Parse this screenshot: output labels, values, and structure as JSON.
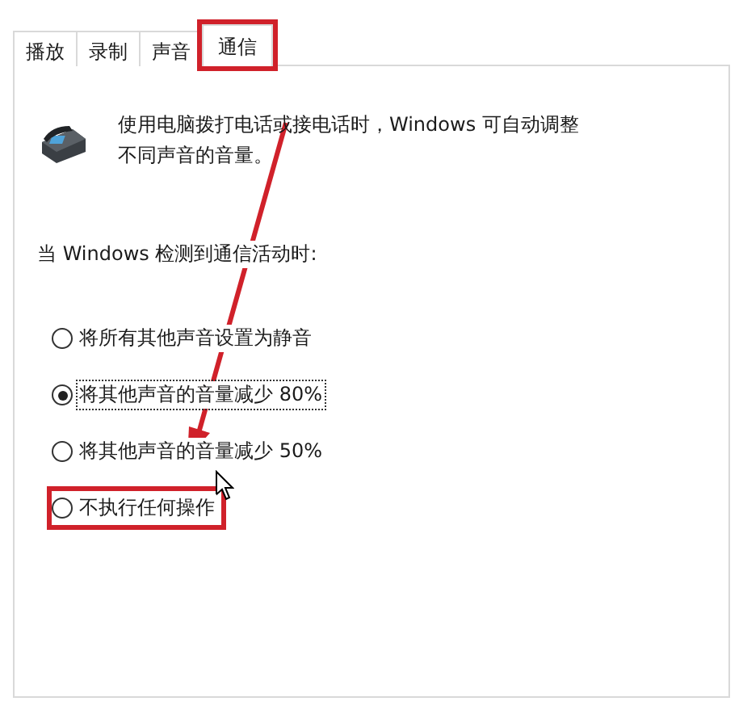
{
  "tabs": [
    {
      "label": "播放",
      "selected": false,
      "highlighted": false
    },
    {
      "label": "录制",
      "selected": false,
      "highlighted": false
    },
    {
      "label": "声音",
      "selected": false,
      "highlighted": false
    },
    {
      "label": "通信",
      "selected": true,
      "highlighted": true
    }
  ],
  "description": "使用电脑拨打电话或接电话时，Windows 可自动调整不同声音的音量。",
  "heading": "当 Windows 检测到通信活动时:",
  "options": [
    {
      "label": "将所有其他声音设置为静音",
      "selected": false,
      "highlighted": false
    },
    {
      "label": "将其他声音的音量减少 80%",
      "selected": true,
      "highlighted": false
    },
    {
      "label": "将其他声音的音量减少 50%",
      "selected": false,
      "highlighted": false
    },
    {
      "label": "不执行任何操作",
      "selected": false,
      "highlighted": true
    }
  ]
}
